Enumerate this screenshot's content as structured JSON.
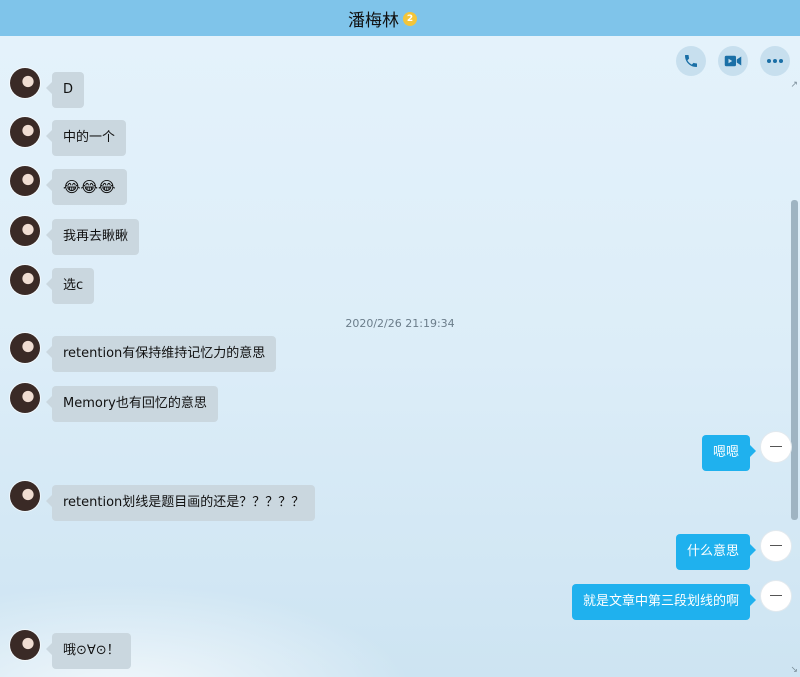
{
  "window": {
    "contact_name": "潘梅林",
    "badge": "2"
  },
  "toolbar": {
    "icons": [
      "phone-icon",
      "video-icon",
      "more-icon"
    ]
  },
  "messages": [
    {
      "side": "in",
      "text": "D"
    },
    {
      "side": "in",
      "text": "中的一个"
    },
    {
      "side": "in",
      "text": "😂😂😂"
    },
    {
      "side": "in",
      "text": "我再去瞅瞅"
    },
    {
      "side": "in",
      "text": "选c"
    },
    {
      "timestamp": "2020/2/26 21:19:34"
    },
    {
      "side": "in",
      "text": "retention有保持维持记忆力的意思"
    },
    {
      "side": "in",
      "text": "Memory也有回忆的意思"
    },
    {
      "side": "out",
      "text": "嗯嗯"
    },
    {
      "side": "in",
      "text": "retention划线是题目画的还是？？？？？"
    },
    {
      "side": "out",
      "text": "什么意思"
    },
    {
      "side": "out",
      "text": "就是文章中第三段划线的啊"
    },
    {
      "side": "in",
      "text": "哦⊙∀⊙！"
    }
  ],
  "colors": {
    "incoming_bubble": "#cad7df",
    "outgoing_bubble": "#1fb1ee",
    "titlebar": "#7fc4ea"
  }
}
